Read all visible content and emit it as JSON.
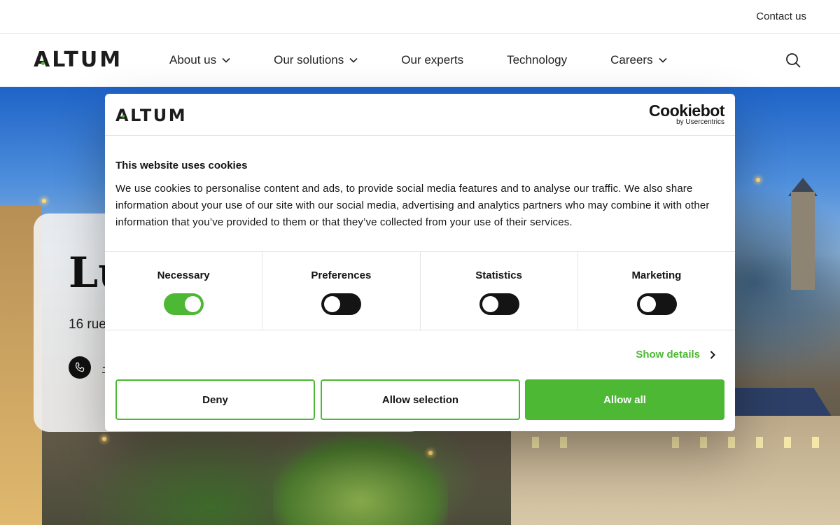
{
  "topbar": {
    "contact_label": "Contact us"
  },
  "brand": {
    "logo_text": "ALTUM"
  },
  "nav": {
    "items": [
      {
        "label": "About us",
        "has_dropdown": true
      },
      {
        "label": "Our solutions",
        "has_dropdown": true
      },
      {
        "label": "Our experts",
        "has_dropdown": false
      },
      {
        "label": "Technology",
        "has_dropdown": false
      },
      {
        "label": "Careers",
        "has_dropdown": true
      }
    ],
    "search_icon": "search-icon"
  },
  "office": {
    "title_visible": "Lu",
    "address_visible": "16 rue",
    "phone_visible": "+",
    "phone_icon": "phone-icon"
  },
  "cookie_dialog": {
    "logo_text": "ALTUM",
    "provider_name": "Cookiebot",
    "provider_sub": "by Usercentrics",
    "title": "This website uses cookies",
    "body": "We use cookies to personalise content and ads, to provide social media features and to analyse our traffic. We also share information about your use of our site with our social media, advertising and analytics partners who may combine it with other information that you’ve provided to them or that they’ve collected from your use of their services.",
    "categories": [
      {
        "label": "Necessary",
        "enabled": true
      },
      {
        "label": "Preferences",
        "enabled": false
      },
      {
        "label": "Statistics",
        "enabled": false
      },
      {
        "label": "Marketing",
        "enabled": false
      }
    ],
    "show_details_label": "Show details",
    "buttons": {
      "deny": "Deny",
      "allow_selection": "Allow selection",
      "allow_all": "Allow all"
    }
  },
  "colors": {
    "accent_green": "#4cb833",
    "text_dark": "#141414",
    "toggle_off": "#141414"
  }
}
